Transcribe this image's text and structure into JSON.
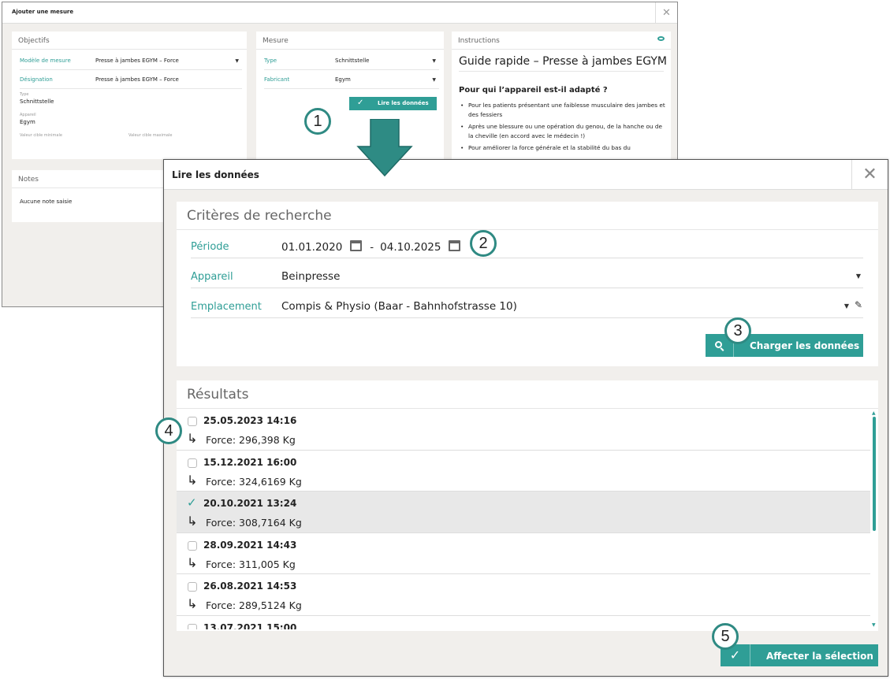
{
  "bg_dialog": {
    "title": "Ajouter une mesure",
    "close": "✕",
    "objectifs": {
      "title": "Objectifs",
      "rows": [
        {
          "label": "Modèle de mesure",
          "value": "Presse à jambes EGYM – Force"
        },
        {
          "label": "Désignation",
          "value": "Presse à jambes EGYM – Force"
        }
      ],
      "type_label": "Type",
      "type_value": "Schnittstelle",
      "appareil_label": "Appareil",
      "appareil_value": "Egym",
      "min_label": "Valeur cible minimale",
      "max_label": "Valeur cible maximale"
    },
    "notes": {
      "title": "Notes",
      "text": "Aucune note saisie"
    },
    "mesure": {
      "title": "Mesure",
      "rows": [
        {
          "label": "Type",
          "value": "Schnittstelle"
        },
        {
          "label": "Fabricant",
          "value": "Egym"
        }
      ],
      "read_button": "Lire les données"
    },
    "instructions": {
      "title": "Instructions",
      "guide_title": "Guide rapide – Presse à jambes EGYM",
      "subtitle": "Pour qui l’appareil est-il adapté ?",
      "items": [
        "Pour les patients présentant une faiblesse musculaire des jambes et des fessiers",
        "Après une blessure ou une opération du genou, de la hanche ou de la cheville (en accord avec le médecin !)",
        "Pour améliorer la force générale et la stabilité du bas du"
      ]
    }
  },
  "badges": [
    "1",
    "2",
    "3",
    "4",
    "5"
  ],
  "fg_dialog": {
    "title": "Lire les données",
    "close": "✕",
    "criteria": {
      "title": "Critères de recherche",
      "periode_label": "Période",
      "date_from": "01.01.2020",
      "dash": "-",
      "date_to": "04.10.2025",
      "appareil_label": "Appareil",
      "appareil_value": "Beinpresse",
      "emplacement_label": "Emplacement",
      "emplacement_value": "Compis & Physio (Baar - Bahnhofstrasse 10)",
      "load_button": "Charger les données"
    },
    "results": {
      "title": "Résultats",
      "items": [
        {
          "date": "25.05.2023 14:16",
          "value": "Force: 296,398 Kg",
          "selected": false
        },
        {
          "date": "15.12.2021 16:00",
          "value": "Force: 324,6169 Kg",
          "selected": false
        },
        {
          "date": "20.10.2021 13:24",
          "value": "Force: 308,7164 Kg",
          "selected": true
        },
        {
          "date": "28.09.2021 14:43",
          "value": "Force: 311,005 Kg",
          "selected": false
        },
        {
          "date": "26.08.2021 14:53",
          "value": "Force: 289,5124 Kg",
          "selected": false
        },
        {
          "date": "13.07.2021 15:00",
          "value": "",
          "selected": false
        }
      ]
    },
    "assign_button": "Affecter la sélection"
  },
  "colors": {
    "accent": "#2f9e96",
    "background": "#f1efec"
  },
  "icons": [
    "close-icon",
    "calendar-icon",
    "search-icon",
    "check-icon",
    "pencil-icon",
    "eye-icon",
    "chevron-down-icon",
    "return-arrow-icon"
  ]
}
